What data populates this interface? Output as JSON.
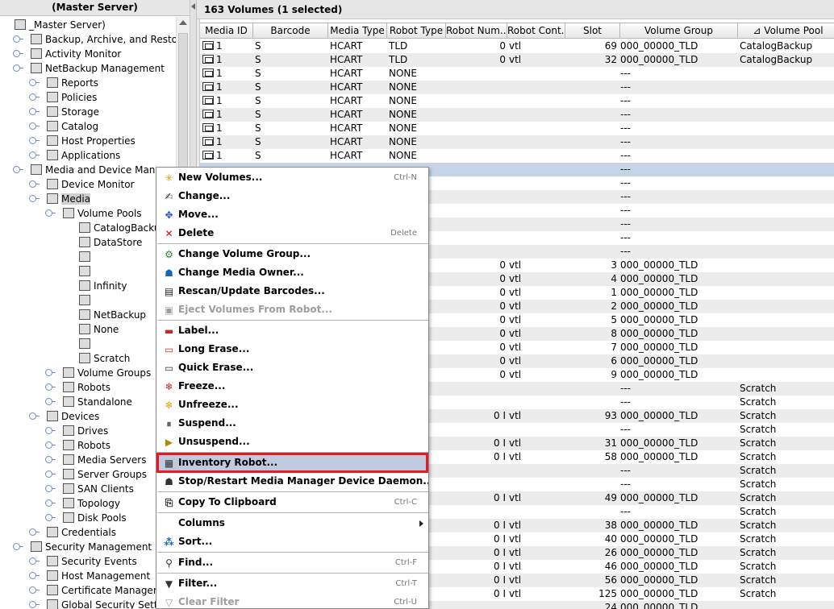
{
  "left_panel": {
    "header": "(Master Server)",
    "tree": [
      {
        "label": "_Master Server)",
        "depth": 0
      },
      {
        "label": "Backup, Archive, and Restore",
        "depth": 1
      },
      {
        "label": "Activity Monitor",
        "depth": 1
      },
      {
        "label": "NetBackup Management",
        "depth": 1
      },
      {
        "label": "Reports",
        "depth": 2
      },
      {
        "label": "Policies",
        "depth": 2
      },
      {
        "label": "Storage",
        "depth": 2
      },
      {
        "label": "Catalog",
        "depth": 2
      },
      {
        "label": "Host Properties",
        "depth": 2
      },
      {
        "label": "Applications",
        "depth": 2
      },
      {
        "label": "Media and Device Management",
        "depth": 1
      },
      {
        "label": "Device Monitor",
        "depth": 2
      },
      {
        "label": "Media",
        "depth": 2,
        "selected": true
      },
      {
        "label": "Volume Pools",
        "depth": 3
      },
      {
        "label": "CatalogBackup",
        "depth": 4
      },
      {
        "label": "DataStore",
        "depth": 4
      },
      {
        "label": "",
        "depth": 4
      },
      {
        "label": "",
        "depth": 4
      },
      {
        "label": "Infinity",
        "depth": 4
      },
      {
        "label": "",
        "depth": 4
      },
      {
        "label": "NetBackup",
        "depth": 4
      },
      {
        "label": "None",
        "depth": 4
      },
      {
        "label": "",
        "depth": 4
      },
      {
        "label": "Scratch",
        "depth": 4
      },
      {
        "label": "Volume Groups",
        "depth": 3
      },
      {
        "label": "Robots",
        "depth": 3
      },
      {
        "label": "Standalone",
        "depth": 3
      },
      {
        "label": "Devices",
        "depth": 2
      },
      {
        "label": "Drives",
        "depth": 3
      },
      {
        "label": "Robots",
        "depth": 3
      },
      {
        "label": "Media Servers",
        "depth": 3
      },
      {
        "label": "Server Groups",
        "depth": 3
      },
      {
        "label": "SAN Clients",
        "depth": 3
      },
      {
        "label": "Topology",
        "depth": 3
      },
      {
        "label": "Disk Pools",
        "depth": 3
      },
      {
        "label": "Credentials",
        "depth": 2
      },
      {
        "label": "Security Management",
        "depth": 1
      },
      {
        "label": "Security Events",
        "depth": 2
      },
      {
        "label": "Host Management",
        "depth": 2
      },
      {
        "label": "Certificate Management",
        "depth": 2
      },
      {
        "label": "Global Security Settings",
        "depth": 2
      }
    ]
  },
  "right_panel": {
    "title": "163 Volumes (1 selected)",
    "columns": [
      "Media ID",
      "Barcode",
      "Media Type",
      "Robot Type",
      "Robot Num...",
      "Robot Cont...",
      "Slot",
      "Volume Group",
      "Volume Pool"
    ],
    "rows": [
      {
        "media_id": "1",
        "barcode": "S",
        "media_type": "HCART",
        "robot_type": "TLD",
        "robot_num": "0",
        "robot_cont": "vtl",
        "slot": "69",
        "volume_group": "000_00000_TLD",
        "volume_pool": "CatalogBackup"
      },
      {
        "media_id": "1",
        "barcode": "S",
        "media_type": "HCART",
        "robot_type": "TLD",
        "robot_num": "0",
        "robot_cont": "vtl",
        "slot": "32",
        "volume_group": "000_00000_TLD",
        "volume_pool": "CatalogBackup"
      },
      {
        "media_id": "1",
        "barcode": "S",
        "media_type": "HCART",
        "robot_type": "NONE",
        "robot_num": "",
        "robot_cont": "",
        "slot": "",
        "volume_group": "---",
        "volume_pool": ""
      },
      {
        "media_id": "1",
        "barcode": "S",
        "media_type": "HCART",
        "robot_type": "NONE",
        "robot_num": "",
        "robot_cont": "",
        "slot": "",
        "volume_group": "---",
        "volume_pool": ""
      },
      {
        "media_id": "1",
        "barcode": "S",
        "media_type": "HCART",
        "robot_type": "NONE",
        "robot_num": "",
        "robot_cont": "",
        "slot": "",
        "volume_group": "---",
        "volume_pool": ""
      },
      {
        "media_id": "1",
        "barcode": "S",
        "media_type": "HCART",
        "robot_type": "NONE",
        "robot_num": "",
        "robot_cont": "",
        "slot": "",
        "volume_group": "---",
        "volume_pool": ""
      },
      {
        "media_id": "1",
        "barcode": "S",
        "media_type": "HCART",
        "robot_type": "NONE",
        "robot_num": "",
        "robot_cont": "",
        "slot": "",
        "volume_group": "---",
        "volume_pool": ""
      },
      {
        "media_id": "1",
        "barcode": "S",
        "media_type": "HCART",
        "robot_type": "NONE",
        "robot_num": "",
        "robot_cont": "",
        "slot": "",
        "volume_group": "---",
        "volume_pool": ""
      },
      {
        "media_id": "1",
        "barcode": "S",
        "media_type": "HCART",
        "robot_type": "NONE",
        "robot_num": "",
        "robot_cont": "",
        "slot": "",
        "volume_group": "---",
        "volume_pool": ""
      },
      {
        "media_id": "",
        "barcode": "",
        "media_type": "",
        "robot_type": "",
        "robot_num": "",
        "robot_cont": "",
        "slot": "",
        "volume_group": "---",
        "volume_pool": "",
        "selected": true
      },
      {
        "media_id": "",
        "barcode": "",
        "media_type": "",
        "robot_type": "",
        "robot_num": "",
        "robot_cont": "",
        "slot": "",
        "volume_group": "---",
        "volume_pool": ""
      },
      {
        "media_id": "",
        "barcode": "",
        "media_type": "",
        "robot_type": "",
        "robot_num": "",
        "robot_cont": "",
        "slot": "",
        "volume_group": "---",
        "volume_pool": ""
      },
      {
        "media_id": "",
        "barcode": "",
        "media_type": "",
        "robot_type": "",
        "robot_num": "",
        "robot_cont": "",
        "slot": "",
        "volume_group": "---",
        "volume_pool": ""
      },
      {
        "media_id": "",
        "barcode": "",
        "media_type": "",
        "robot_type": "",
        "robot_num": "",
        "robot_cont": "",
        "slot": "",
        "volume_group": "---",
        "volume_pool": ""
      },
      {
        "media_id": "",
        "barcode": "",
        "media_type": "",
        "robot_type": "",
        "robot_num": "",
        "robot_cont": "",
        "slot": "",
        "volume_group": "---",
        "volume_pool": ""
      },
      {
        "media_id": "",
        "barcode": "",
        "media_type": "",
        "robot_type": "",
        "robot_num": "",
        "robot_cont": "",
        "slot": "",
        "volume_group": "---",
        "volume_pool": ""
      },
      {
        "media_id": "",
        "barcode": "",
        "media_type": "",
        "robot_type": "",
        "robot_num": "0",
        "robot_cont": "vtl",
        "slot": "3",
        "volume_group": "000_00000_TLD",
        "volume_pool": ""
      },
      {
        "media_id": "",
        "barcode": "",
        "media_type": "",
        "robot_type": "",
        "robot_num": "0",
        "robot_cont": "vtl",
        "slot": "4",
        "volume_group": "000_00000_TLD",
        "volume_pool": ""
      },
      {
        "media_id": "",
        "barcode": "",
        "media_type": "",
        "robot_type": "",
        "robot_num": "0",
        "robot_cont": "vtl",
        "slot": "1",
        "volume_group": "000_00000_TLD",
        "volume_pool": ""
      },
      {
        "media_id": "",
        "barcode": "",
        "media_type": "",
        "robot_type": "",
        "robot_num": "0",
        "robot_cont": "vtl",
        "slot": "2",
        "volume_group": "000_00000_TLD",
        "volume_pool": ""
      },
      {
        "media_id": "",
        "barcode": "",
        "media_type": "",
        "robot_type": "",
        "robot_num": "0",
        "robot_cont": "vtl",
        "slot": "5",
        "volume_group": "000_00000_TLD",
        "volume_pool": ""
      },
      {
        "media_id": "",
        "barcode": "",
        "media_type": "",
        "robot_type": "",
        "robot_num": "0",
        "robot_cont": "vtl",
        "slot": "8",
        "volume_group": "000_00000_TLD",
        "volume_pool": ""
      },
      {
        "media_id": "",
        "barcode": "",
        "media_type": "",
        "robot_type": "",
        "robot_num": "0",
        "robot_cont": "vtl",
        "slot": "7",
        "volume_group": "000_00000_TLD",
        "volume_pool": ""
      },
      {
        "media_id": "",
        "barcode": "",
        "media_type": "",
        "robot_type": "",
        "robot_num": "0",
        "robot_cont": "vtl",
        "slot": "6",
        "volume_group": "000_00000_TLD",
        "volume_pool": ""
      },
      {
        "media_id": "",
        "barcode": "",
        "media_type": "",
        "robot_type": "",
        "robot_num": "0",
        "robot_cont": "vtl",
        "slot": "9",
        "volume_group": "000_00000_TLD",
        "volume_pool": ""
      },
      {
        "media_id": "",
        "barcode": "",
        "media_type": "",
        "robot_type": "",
        "robot_num": "",
        "robot_cont": "",
        "slot": "",
        "volume_group": "---",
        "volume_pool": "Scratch"
      },
      {
        "media_id": "",
        "barcode": "",
        "media_type": "",
        "robot_type": "",
        "robot_num": "",
        "robot_cont": "",
        "slot": "",
        "volume_group": "---",
        "volume_pool": "Scratch"
      },
      {
        "media_id": "",
        "barcode": "",
        "media_type": "",
        "robot_type": "",
        "robot_num": "0 I",
        "robot_cont": "vtl",
        "slot": "93",
        "volume_group": "000_00000_TLD",
        "volume_pool": "Scratch"
      },
      {
        "media_id": "",
        "barcode": "",
        "media_type": "",
        "robot_type": "",
        "robot_num": "",
        "robot_cont": "",
        "slot": "",
        "volume_group": "---",
        "volume_pool": "Scratch"
      },
      {
        "media_id": "",
        "barcode": "",
        "media_type": "",
        "robot_type": "",
        "robot_num": "0 I",
        "robot_cont": "vtl",
        "slot": "31",
        "volume_group": "000_00000_TLD",
        "volume_pool": "Scratch"
      },
      {
        "media_id": "",
        "barcode": "",
        "media_type": "",
        "robot_type": "",
        "robot_num": "0 I",
        "robot_cont": "vtl",
        "slot": "58",
        "volume_group": "000_00000_TLD",
        "volume_pool": "Scratch"
      },
      {
        "media_id": "",
        "barcode": "",
        "media_type": "",
        "robot_type": "",
        "robot_num": "",
        "robot_cont": "",
        "slot": "",
        "volume_group": "---",
        "volume_pool": "Scratch"
      },
      {
        "media_id": "",
        "barcode": "",
        "media_type": "",
        "robot_type": "",
        "robot_num": "",
        "robot_cont": "",
        "slot": "",
        "volume_group": "---",
        "volume_pool": "Scratch"
      },
      {
        "media_id": "",
        "barcode": "",
        "media_type": "",
        "robot_type": "",
        "robot_num": "0 I",
        "robot_cont": "vtl",
        "slot": "49",
        "volume_group": "000_00000_TLD",
        "volume_pool": "Scratch"
      },
      {
        "media_id": "",
        "barcode": "",
        "media_type": "",
        "robot_type": "",
        "robot_num": "",
        "robot_cont": "",
        "slot": "",
        "volume_group": "---",
        "volume_pool": "Scratch"
      },
      {
        "media_id": "",
        "barcode": "",
        "media_type": "",
        "robot_type": "",
        "robot_num": "0 I",
        "robot_cont": "vtl",
        "slot": "38",
        "volume_group": "000_00000_TLD",
        "volume_pool": "Scratch"
      },
      {
        "media_id": "",
        "barcode": "",
        "media_type": "",
        "robot_type": "",
        "robot_num": "0 I",
        "robot_cont": "vtl",
        "slot": "40",
        "volume_group": "000_00000_TLD",
        "volume_pool": "Scratch"
      },
      {
        "media_id": "",
        "barcode": "",
        "media_type": "",
        "robot_type": "",
        "robot_num": "0 I",
        "robot_cont": "vtl",
        "slot": "26",
        "volume_group": "000_00000_TLD",
        "volume_pool": "Scratch"
      },
      {
        "media_id": "",
        "barcode": "",
        "media_type": "",
        "robot_type": "",
        "robot_num": "0 I",
        "robot_cont": "vtl",
        "slot": "46",
        "volume_group": "000_00000_TLD",
        "volume_pool": "Scratch"
      },
      {
        "media_id": "",
        "barcode": "",
        "media_type": "",
        "robot_type": "",
        "robot_num": "0 I",
        "robot_cont": "vtl",
        "slot": "56",
        "volume_group": "000_00000_TLD",
        "volume_pool": "Scratch"
      },
      {
        "media_id": "",
        "barcode": "",
        "media_type": "",
        "robot_type": "",
        "robot_num": "0 I",
        "robot_cont": "vtl",
        "slot": "125",
        "volume_group": "000_00000_TLD",
        "volume_pool": "Scratch"
      },
      {
        "media_id": "",
        "barcode": "",
        "media_type": "",
        "robot_type": "",
        "robot_num": "",
        "robot_cont": "",
        "slot": "24",
        "volume_group": "000_00000_TLD",
        "volume_pool": ""
      }
    ]
  },
  "context_menu": {
    "items": [
      {
        "type": "item",
        "label": "New Volumes...",
        "accel": "Ctrl-N",
        "icon": "sparkle-icon",
        "glyph": "✳",
        "color": "#d8a000"
      },
      {
        "type": "item",
        "label": "Change...",
        "accel": "",
        "icon": "change-icon",
        "glyph": "✍",
        "color": "#333333"
      },
      {
        "type": "item",
        "label": "Move...",
        "accel": "",
        "icon": "move-icon",
        "glyph": "✥",
        "color": "#1f49c7"
      },
      {
        "type": "item",
        "label": "Delete",
        "accel": "Delete",
        "icon": "delete-icon",
        "glyph": "✕",
        "color": "#d01010"
      },
      {
        "type": "sep"
      },
      {
        "type": "item",
        "label": "Change Volume Group...",
        "accel": "",
        "icon": "volume-group-icon",
        "glyph": "⚙",
        "color": "#2e7d32"
      },
      {
        "type": "item",
        "label": "Change Media Owner...",
        "accel": "",
        "icon": "media-owner-icon",
        "glyph": "☗",
        "color": "#1565c0"
      },
      {
        "type": "item",
        "label": "Rescan/Update Barcodes...",
        "accel": "",
        "icon": "barcode-icon",
        "glyph": "▤",
        "color": "#222222"
      },
      {
        "type": "item",
        "label": "Eject Volumes From Robot...",
        "accel": "",
        "icon": "eject-icon",
        "glyph": "▣",
        "color": "#9e9e9e",
        "disabled": true
      },
      {
        "type": "sep"
      },
      {
        "type": "item",
        "label": "Label...",
        "accel": "",
        "icon": "label-icon",
        "glyph": "▬",
        "color": "#c62828"
      },
      {
        "type": "item",
        "label": "Long Erase...",
        "accel": "",
        "icon": "long-erase-icon",
        "glyph": "▭",
        "color": "#c62828"
      },
      {
        "type": "item",
        "label": "Quick Erase...",
        "accel": "",
        "icon": "quick-erase-icon",
        "glyph": "▭",
        "color": "#333333"
      },
      {
        "type": "item",
        "label": "Freeze...",
        "accel": "",
        "icon": "freeze-icon",
        "glyph": "❄",
        "color": "#c62828"
      },
      {
        "type": "item",
        "label": "Unfreeze...",
        "accel": "",
        "icon": "unfreeze-icon",
        "glyph": "❄",
        "color": "#e0a000"
      },
      {
        "type": "item",
        "label": "Suspend...",
        "accel": "",
        "icon": "suspend-icon",
        "glyph": "⏸",
        "color": "#555555"
      },
      {
        "type": "item",
        "label": "Unsuspend...",
        "accel": "",
        "icon": "unsuspend-icon",
        "glyph": "▶",
        "color": "#b08a00"
      },
      {
        "type": "sep"
      },
      {
        "type": "item",
        "label": "Inventory Robot...",
        "accel": "",
        "icon": "inventory-robot-icon",
        "glyph": "▦",
        "color": "#333333",
        "highlighted": true
      },
      {
        "type": "item",
        "label": "Stop/Restart Media Manager Device Daemon...",
        "accel": "",
        "icon": "daemon-icon",
        "glyph": "☗",
        "color": "#333333"
      },
      {
        "type": "sep"
      },
      {
        "type": "item",
        "label": "Copy To Clipboard",
        "accel": "Ctrl-C",
        "icon": "clipboard-icon",
        "glyph": "⎘",
        "color": "#333333"
      },
      {
        "type": "sep"
      },
      {
        "type": "item",
        "label": "Columns",
        "accel": "",
        "icon": "",
        "glyph": "",
        "color": "#333333",
        "submenu": true
      },
      {
        "type": "item",
        "label": "Sort...",
        "accel": "",
        "icon": "sort-icon",
        "glyph": "⁂",
        "color": "#1565c0"
      },
      {
        "type": "sep"
      },
      {
        "type": "item",
        "label": "Find...",
        "accel": "Ctrl-F",
        "icon": "find-icon",
        "glyph": "⚲",
        "color": "#333333"
      },
      {
        "type": "sep"
      },
      {
        "type": "item",
        "label": "Filter...",
        "accel": "Ctrl-T",
        "icon": "filter-icon",
        "glyph": "▼",
        "color": "#333333"
      },
      {
        "type": "item",
        "label": "Clear Filter",
        "accel": "Ctrl-U",
        "icon": "clear-filter-icon",
        "glyph": "▽",
        "color": "#9e9e9e",
        "disabled": true
      }
    ]
  },
  "colors": {
    "selection_row": "#c5d4e6",
    "highlight_border": "#e51a26",
    "alt_row": "#ececec"
  }
}
